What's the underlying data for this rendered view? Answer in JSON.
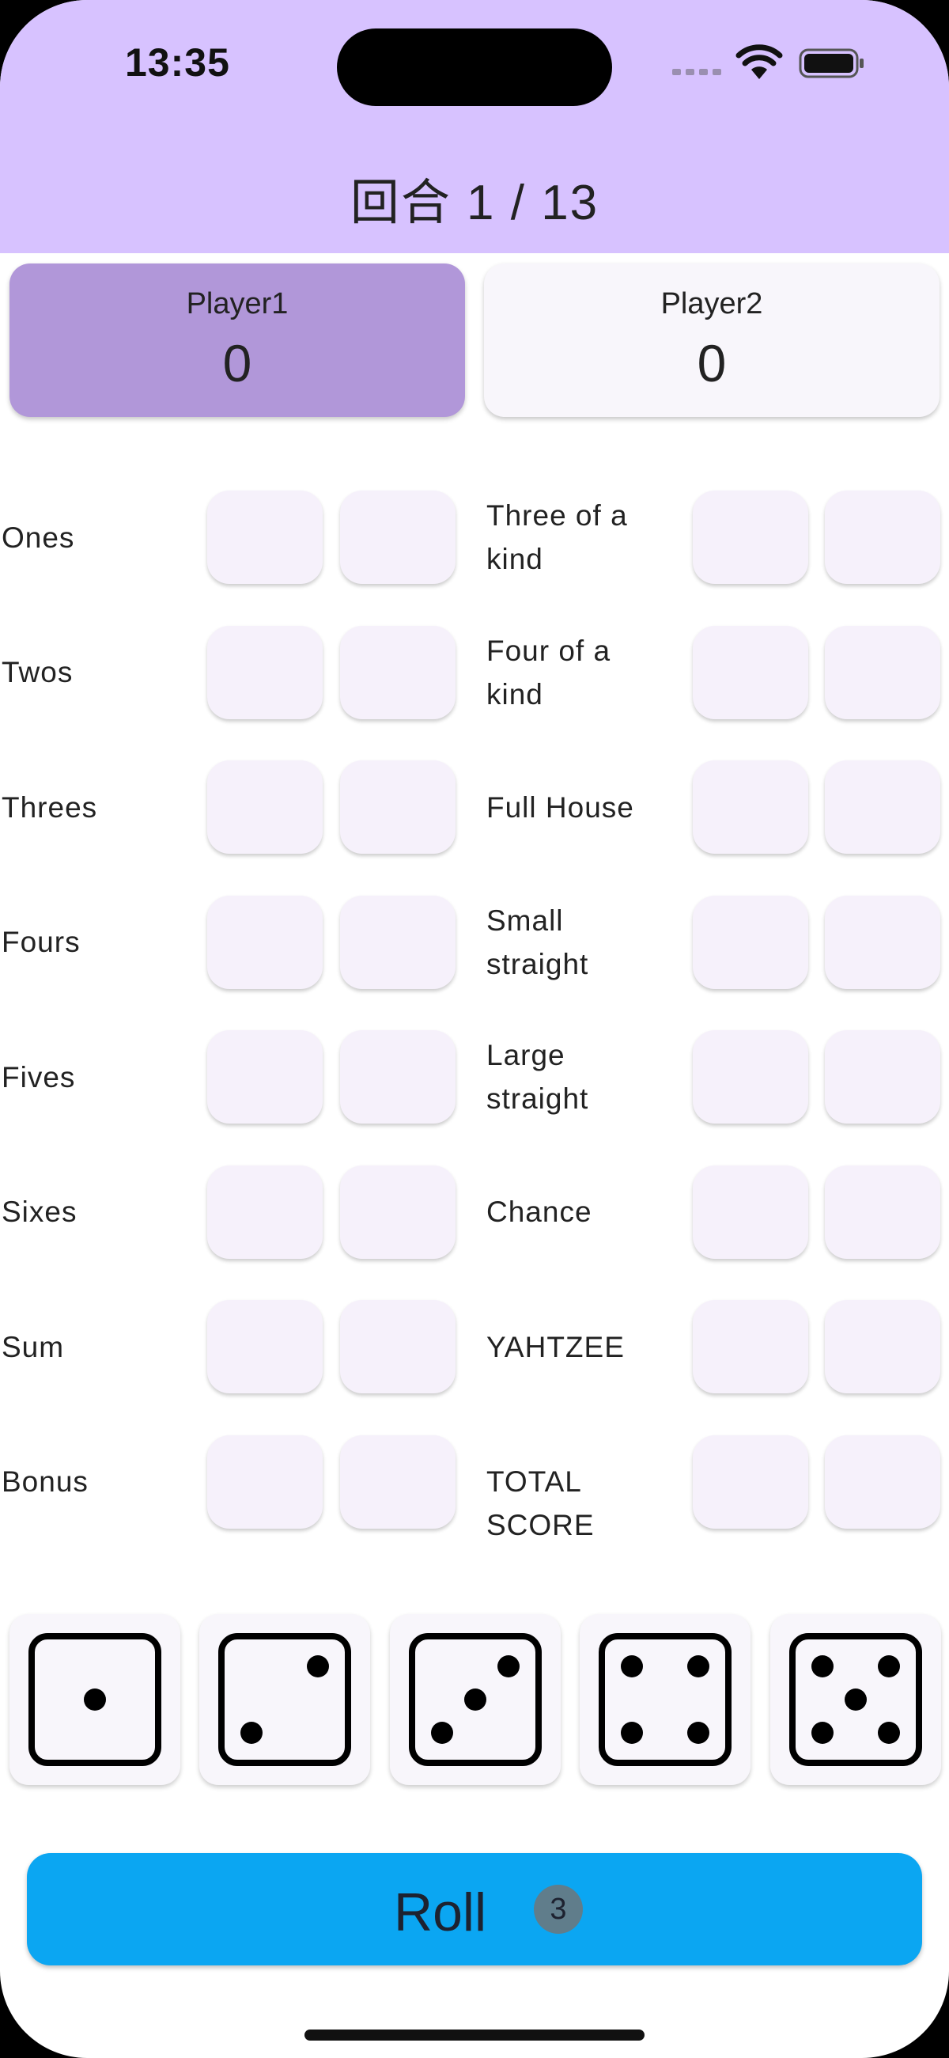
{
  "status_bar": {
    "time": "13:35"
  },
  "header": {
    "title": "回合 1 / 13"
  },
  "players": [
    {
      "name": "Player1",
      "score": "0",
      "active": true
    },
    {
      "name": "Player2",
      "score": "0",
      "active": false
    }
  ],
  "scorecard": {
    "upper": [
      "Ones",
      "Twos",
      "Threes",
      "Fours",
      "Fives",
      "Sixes",
      "Sum",
      "Bonus"
    ],
    "lower": [
      "Three of a kind",
      "Four of a kind",
      "Full House",
      "Small straight",
      "Large straight",
      "Chance",
      "YAHTZEE",
      "TOTAL SCORE"
    ]
  },
  "dice": [
    1,
    2,
    3,
    4,
    5
  ],
  "roll_button": {
    "label": "Roll",
    "rolls_left": "3"
  },
  "colors": {
    "header": "#d7c2ff",
    "active_player": "#b197d9",
    "roll_button": "#0ba6f2",
    "badge": "#607d8b"
  }
}
